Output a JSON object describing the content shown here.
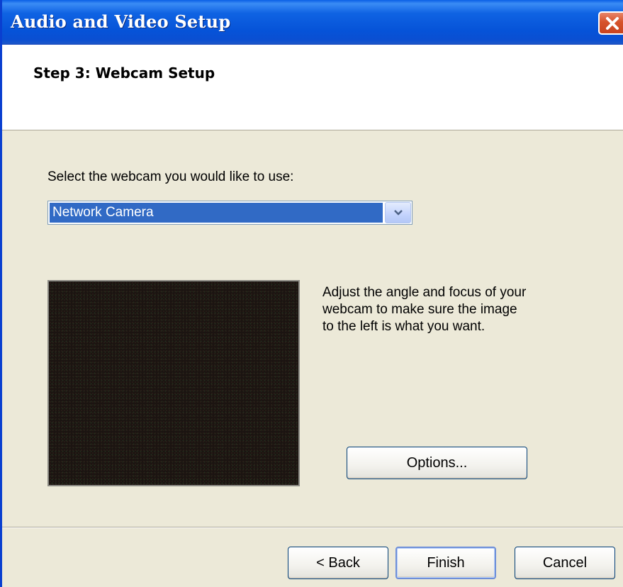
{
  "window": {
    "title": "Audio and Video Setup"
  },
  "header": {
    "step_title": "Step 3: Webcam Setup"
  },
  "webcam": {
    "select_label": "Select the webcam you would like to use:",
    "selected_value": "Network Camera",
    "instructions": "Adjust the angle and focus of your\nwebcam to make sure the image\nto the left is what you want.",
    "options_label": "Options..."
  },
  "footer": {
    "back_label": "< Back",
    "finish_label": "Finish",
    "cancel_label": "Cancel"
  },
  "icons": {
    "close": "close-icon",
    "dropdown_arrow": "chevron-down-icon"
  },
  "colors": {
    "titlebar": "#0a5fe6",
    "selection": "#316ac5",
    "close_button": "#d6522b",
    "dialog_background": "#ece9d8"
  }
}
